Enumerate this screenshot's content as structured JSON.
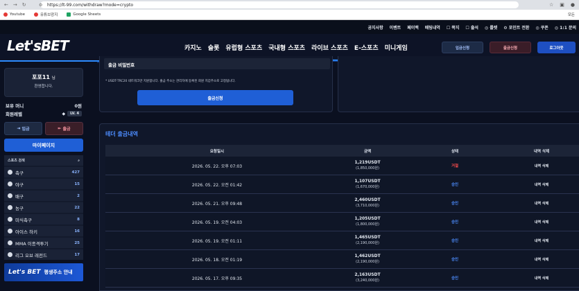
{
  "browser": {
    "url": "https://lt-99.com/withdraw?mode=crypto",
    "bookmarks": [
      "Youtube",
      "유튜브광지",
      "Google Sheets"
    ],
    "bookmark_colors": [
      "#e53935",
      "#e53935",
      "#1ea362"
    ],
    "right_bookmark": "모든"
  },
  "topbar": [
    "공지사항",
    "이벤트",
    "페이백",
    "배팅내역",
    "☐ 쪽지",
    "☐ 출석",
    "◎ 룰렛",
    "⚙ 포인트 전환",
    "◎ 쿠폰",
    "◎ 1:1 문의"
  ],
  "header": {
    "logo_lets": "Let's",
    "logo_bet": "BET",
    "menu": [
      "카지노",
      "슬롯",
      "유럽형 스포츠",
      "국내형 스포츠",
      "라이브 스포츠",
      "E-스포츠",
      "미니게임"
    ],
    "deposit_btn": "입금신청",
    "withdraw_btn": "출금신청",
    "logout_btn": "로그아웃"
  },
  "sidebar": {
    "username": "포포11",
    "suffix": "님",
    "greeting": "환영합니다.",
    "money_label": "보유 머니",
    "money_value": "0원",
    "level_label": "회원레벨",
    "level_value": "LV. 4",
    "deposit": "입금",
    "withdraw": "출금",
    "mypage": "마이페이지",
    "sports_header": "스포츠 검색",
    "sports": [
      {
        "name": "축구",
        "count": "427"
      },
      {
        "name": "야구",
        "count": "15"
      },
      {
        "name": "배구",
        "count": "2"
      },
      {
        "name": "농구",
        "count": "22"
      },
      {
        "name": "미식축구",
        "count": "8"
      },
      {
        "name": "아이스 하키",
        "count": "16"
      },
      {
        "name": "MMA 이종격투기",
        "count": "25"
      },
      {
        "name": "리그 오브 레전드",
        "count": "17"
      }
    ],
    "banner_logo": "Let's BET",
    "banner_text": "평생주소 안내"
  },
  "withdraw_form": {
    "password_label": "출금 비밀번호",
    "note": "* USDT-TRC20 네트워크만 지원합니다. 출금 주소는 관리자에 등록된 회원 지갑주소로 고정됩니다.",
    "submit": "출금신청"
  },
  "history": {
    "title": "테더 출금내역",
    "columns": [
      "요청일시",
      "금액",
      "상태",
      "내역 삭제"
    ],
    "rows": [
      {
        "date": "2026. 05. 22. 오후 07:03",
        "usdt": "1,219USDT",
        "krw": "(1,850,000원)",
        "status": "거절",
        "status_color": "#ff4d4d",
        "del": "내역 삭제"
      },
      {
        "date": "2026. 05. 22. 오전 01:42",
        "usdt": "1,107USDT",
        "krw": "(1,670,000원)",
        "status": "승인",
        "status_color": "#4d8dff",
        "del": "내역 삭제"
      },
      {
        "date": "2026. 05. 21. 오후 09:48",
        "usdt": "2,460USDT",
        "krw": "(3,710,000원)",
        "status": "승인",
        "status_color": "#4d8dff",
        "del": "내역 삭제"
      },
      {
        "date": "2026. 05. 19. 오전 04:03",
        "usdt": "1,205USDT",
        "krw": "(1,800,000원)",
        "status": "승인",
        "status_color": "#4d8dff",
        "del": "내역 삭제"
      },
      {
        "date": "2026. 05. 19. 오전 01:11",
        "usdt": "1,465USDT",
        "krw": "(2,190,000원)",
        "status": "승인",
        "status_color": "#4d8dff",
        "del": "내역 삭제"
      },
      {
        "date": "2026. 05. 18. 오전 01:19",
        "usdt": "1,462USDT",
        "krw": "(2,190,000원)",
        "status": "승인",
        "status_color": "#4d8dff",
        "del": "내역 삭제"
      },
      {
        "date": "2026. 05. 17. 오후 09:35",
        "usdt": "2,163USDT",
        "krw": "(3,240,000원)",
        "status": "승인",
        "status_color": "#4d8dff",
        "del": "내역 삭제"
      }
    ]
  }
}
